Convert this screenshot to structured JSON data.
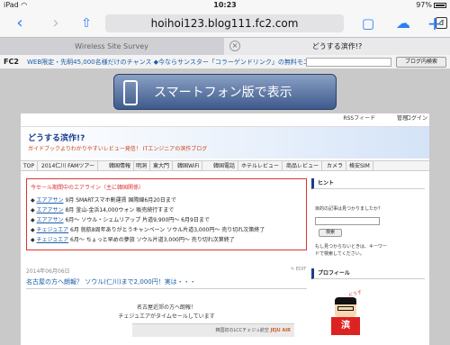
{
  "status": {
    "device": "iPad",
    "wifi": "◠",
    "time": "10:23",
    "battery": "97%"
  },
  "toolbar": {
    "back": "‹",
    "forward": "›",
    "share": "⇧",
    "url": "hoihoi123.blog111.fc2.com",
    "reader": "đ",
    "tabs_icon": "▢",
    "cloud": "☁",
    "new_tab": "+"
  },
  "tabs": [
    {
      "title": "Wireless Site Survey"
    },
    {
      "title": "どうする滨作!?",
      "close": "×"
    }
  ],
  "ad_bar": {
    "logo": "FC2",
    "text": "WEB限定・先眀45,000名様だけのチャンス ◆今ならサンスター「コラーゲンドリンク」の無料モニターを募",
    "button": "ブログ内検索"
  },
  "banner": {
    "text": "スマートフォン版で表示"
  },
  "blog": {
    "rss": "RSSフィード",
    "admin": "管理",
    "login": "ログイン",
    "title": "どうする滨作!?",
    "subtitle": "ガイドブックよりわかりやすいレビュー発信！ ITエンジニアの滨作ブログ",
    "nav": [
      "TOP",
      "2014仁川 FAMツアー",
      "韓国情報",
      "明洞",
      "東大門",
      "韓国WiFi",
      "韓国電話",
      "ホテルレビュー",
      "商品レビュー",
      "カメラ",
      "格安SIM"
    ]
  },
  "notice": {
    "title": "今セール期間中のエアライン（主に韓国関係）",
    "rows": [
      {
        "carrier": "エアアサン",
        "text": "9月 SMARTスマホ割運賃 国際線6月20日まで"
      },
      {
        "carrier": "エアアサン",
        "text": "8月 釜山-金浜14,000ウォン 販売続行すまで"
      },
      {
        "carrier": "エアアサン",
        "text": "6月～ ソウル・シェムリアップ 片道9,900円～ 6月9日まで"
      },
      {
        "carrier": "チェジュエア",
        "text": "6月 就航8周年ありがとうキャンペーン ソウル片道3,000円～ 売り切れ次第終了"
      },
      {
        "carrier": "チェジュエア",
        "text": "6月～ ちょっと早めの夢旅 ソウル片道3,000円～ 売り切れ次第終了"
      }
    ]
  },
  "post": {
    "date": "2014年06月06日",
    "edit": "✎ EDIT",
    "title": "名古屋の方へ朗報？ ソウル(仁川)まで2,000円！実は・・・",
    "line1": "名古屋近郊の方へ朗報！",
    "line2": "チェジュエアがタイムセールしています",
    "image_text": "韓国初のLCCチェジュ航空",
    "image_brand": "JEJU AIR"
  },
  "sidebar": {
    "hint_title": "ヒント",
    "hint_q": "目的の記事は見つかりましたか？",
    "search_btn": "検索",
    "hint_1": "もし見つからないときは、キーワー",
    "hint_2": "ドで検索してください。",
    "profile_title": "プロフィール",
    "mascot_text": "滨",
    "mascot_speech": "どうする？"
  }
}
